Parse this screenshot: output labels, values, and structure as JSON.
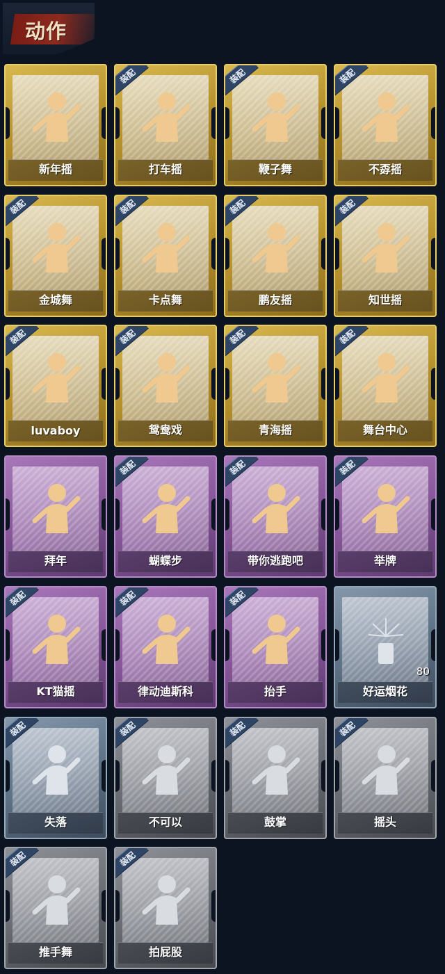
{
  "header": {
    "title": "动作"
  },
  "equip_badge": "装配",
  "cards": [
    {
      "label": "新年摇",
      "style": "gold",
      "equipped": false
    },
    {
      "label": "打车摇",
      "style": "gold",
      "equipped": true
    },
    {
      "label": "鞭子舞",
      "style": "gold",
      "equipped": true
    },
    {
      "label": "不孬摇",
      "style": "gold",
      "equipped": true
    },
    {
      "label": "金城舞",
      "style": "gold",
      "equipped": true
    },
    {
      "label": "卡点舞",
      "style": "gold",
      "equipped": true
    },
    {
      "label": "鹏友摇",
      "style": "gold",
      "equipped": true
    },
    {
      "label": "知世摇",
      "style": "gold",
      "equipped": true
    },
    {
      "label": "luvaboy",
      "style": "gold",
      "equipped": true
    },
    {
      "label": "鸳鸯戏",
      "style": "gold",
      "equipped": true
    },
    {
      "label": "青海摇",
      "style": "gold",
      "equipped": true
    },
    {
      "label": "舞台中心",
      "style": "gold",
      "equipped": true
    },
    {
      "label": "拜年",
      "style": "purple",
      "equipped": false
    },
    {
      "label": "蝴蝶步",
      "style": "purple",
      "equipped": true
    },
    {
      "label": "带你逃跑吧",
      "style": "purple",
      "equipped": true
    },
    {
      "label": "举牌",
      "style": "purple",
      "equipped": true
    },
    {
      "label": "KT猫摇",
      "style": "purple",
      "equipped": true
    },
    {
      "label": "律动迪斯科",
      "style": "purple",
      "equipped": true
    },
    {
      "label": "抬手",
      "style": "purple",
      "equipped": true
    },
    {
      "label": "好运烟花",
      "style": "blue",
      "equipped": false,
      "count": "80"
    },
    {
      "label": "失落",
      "style": "blue",
      "equipped": true
    },
    {
      "label": "不可以",
      "style": "grey",
      "equipped": true
    },
    {
      "label": "鼓掌",
      "style": "grey",
      "equipped": true
    },
    {
      "label": "摇头",
      "style": "grey",
      "equipped": true
    },
    {
      "label": "推手舞",
      "style": "grey",
      "equipped": true
    },
    {
      "label": "拍屁股",
      "style": "grey",
      "equipped": true
    }
  ]
}
